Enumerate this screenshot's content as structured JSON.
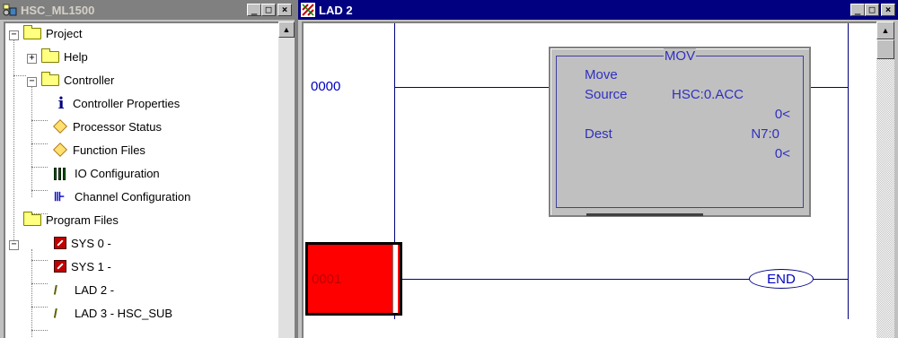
{
  "left_window": {
    "title": "HSC_ML1500",
    "tree": {
      "root": "Project",
      "help": "Help",
      "controller": "Controller",
      "controller_items": [
        "Controller Properties",
        "Processor Status",
        "Function Files",
        "IO Configuration",
        "Channel Configuration"
      ],
      "program_files": "Program Files",
      "program_items": [
        "SYS 0 -",
        "SYS 1 -",
        "LAD 2 -",
        "LAD 3 - HSC_SUB"
      ]
    }
  },
  "right_window": {
    "title": "LAD 2",
    "rungs": [
      "0000",
      "0001"
    ],
    "mov": {
      "title": "MOV",
      "name": "Move",
      "source_label": "Source",
      "source_value": "HSC:0.ACC",
      "source_data": "0<",
      "dest_label": "Dest",
      "dest_value": "N7:0",
      "dest_data": "0<"
    },
    "end_label": "END"
  },
  "title_buttons": {
    "minimize": "_",
    "maximize": "□",
    "close": "×"
  },
  "colors": {
    "active_title": "#000080",
    "inactive_title": "#808080",
    "selected_rung": "#ff0000",
    "ladder_text": "#0000c0"
  }
}
